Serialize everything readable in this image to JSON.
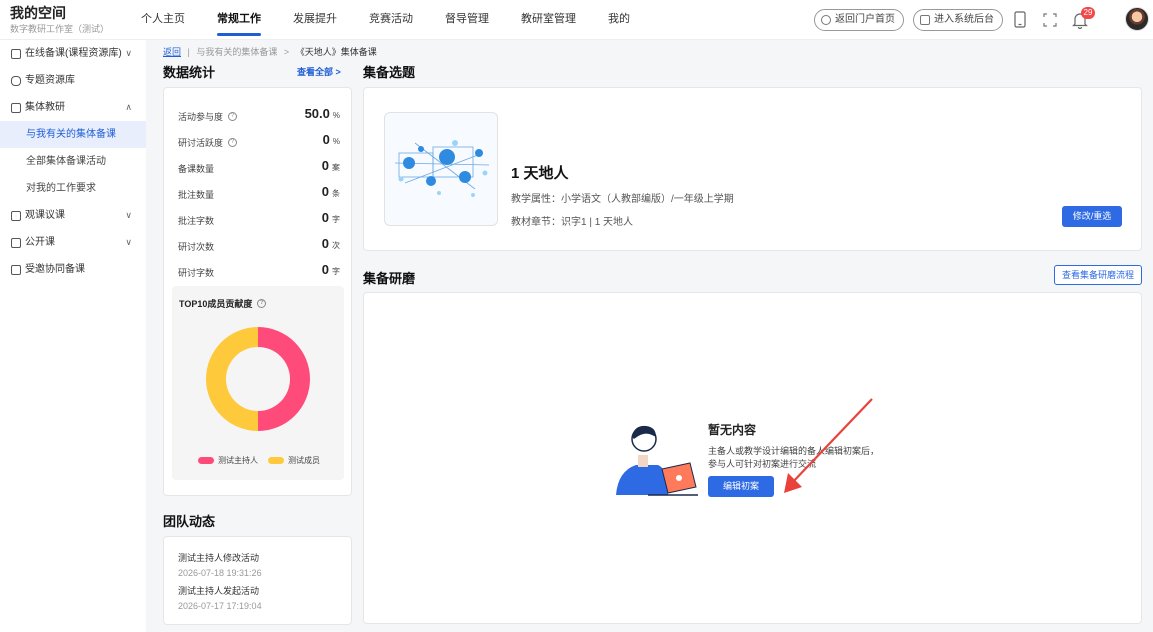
{
  "brand": {
    "title": "我的空间",
    "subtitle": "数字教研工作室（测试）"
  },
  "nav": {
    "items": [
      "个人主页",
      "常规工作",
      "发展提升",
      "竞赛活动",
      "督导管理",
      "教研室管理",
      "我的"
    ],
    "active_index": 1
  },
  "header": {
    "portal_label": "返回门户首页",
    "admin_label": "进入系统后台",
    "notification_count": "29"
  },
  "sidebar": {
    "items": [
      {
        "label": "在线备课(课程资源库)",
        "chevron": "∨"
      },
      {
        "label": "专题资源库"
      },
      {
        "label": "集体教研",
        "chevron": "∧"
      },
      {
        "label": "与我有关的集体备课",
        "sub": true,
        "active": true
      },
      {
        "label": "全部集体备课活动",
        "sub": true
      },
      {
        "label": "对我的工作要求",
        "sub": true
      },
      {
        "label": "观课议课",
        "chevron": "∨"
      },
      {
        "label": "公开课",
        "chevron": "∨"
      },
      {
        "label": "受邀协同备课"
      }
    ]
  },
  "breadcrumb": {
    "back": "返回",
    "sep": "|",
    "parent": "与我有关的集体备课",
    "arrow": ">",
    "current": "《天地人》集体备课"
  },
  "stats": {
    "title": "数据统计",
    "more": "查看全部 >",
    "rows": [
      {
        "label": "活动参与度",
        "value": "50.0",
        "unit": "%",
        "help": true
      },
      {
        "label": "研讨活跃度",
        "value": "0",
        "unit": "%",
        "help": true
      },
      {
        "label": "备课数量",
        "value": "0",
        "unit": "案"
      },
      {
        "label": "批注数量",
        "value": "0",
        "unit": "条"
      },
      {
        "label": "批注字数",
        "value": "0",
        "unit": "字"
      },
      {
        "label": "研讨次数",
        "value": "0",
        "unit": "次"
      },
      {
        "label": "研讨字数",
        "value": "0",
        "unit": "字"
      }
    ],
    "top10_title": "TOP10成员贡献度"
  },
  "chart_data": {
    "type": "pie",
    "title": "TOP10成员贡献度",
    "categories": [
      "测试主持人",
      "测试成员"
    ],
    "values": [
      50,
      50
    ],
    "colors": [
      "#ff4b7a",
      "#ffc93c"
    ],
    "legend": "bottom"
  },
  "team": {
    "title": "团队动态",
    "items": [
      {
        "text": "测试主持人修改活动",
        "time": "2026-07-18 19:31:26"
      },
      {
        "text": "测试主持人发起活动",
        "time": "2026-07-17 17:19:04"
      }
    ]
  },
  "topic": {
    "section_title": "集备选题",
    "name": "1 天地人",
    "attr": "教学属性：小学语文（人教部编版）/一年级上学期",
    "chapter": "教材章节：识字1 | 1 天地人",
    "edit_button": "修改/重选"
  },
  "research": {
    "section_title": "集备研磨",
    "flow_button": "查看集备研磨流程",
    "empty_title": "暂无内容",
    "empty_line1": "主备人或教学设计编辑的备人编辑初案后，",
    "empty_line2": "参与人可针对初案进行交流",
    "edit_button": "编辑初案"
  },
  "colors": {
    "accent": "#2d6ae3",
    "pink": "#ff4b7a",
    "yellow": "#ffc93c",
    "arrow": "#e8423a"
  }
}
